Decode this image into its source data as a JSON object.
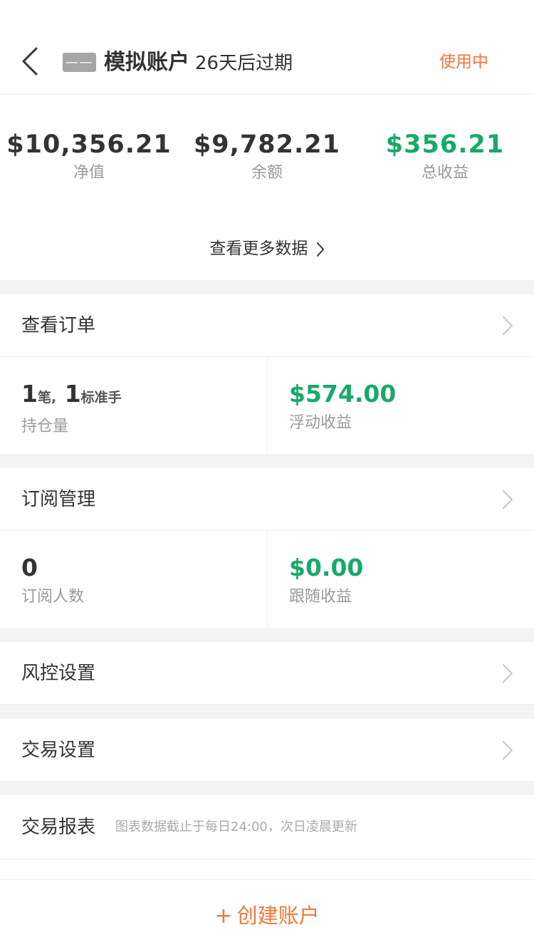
{
  "header": {
    "back_icon": "chevron-left-icon",
    "badge": "——",
    "title": "模拟账户",
    "expiry": "26天后过期",
    "status": "使用中"
  },
  "summary": {
    "net_value": {
      "value": "$10,356.21",
      "label": "净值"
    },
    "balance": {
      "value": "$9,782.21",
      "label": "余额"
    },
    "total_profit": {
      "value": "$356.21",
      "label": "总收益"
    },
    "more_link": "查看更多数据"
  },
  "orders": {
    "label": "查看订单",
    "positions_count": "1",
    "positions_unit": "笔,",
    "lots_count": "1",
    "lots_unit": "标准手",
    "positions_label": "持仓量",
    "floating_value": "$574.00",
    "floating_label": "浮动收益"
  },
  "subscription": {
    "label": "订阅管理",
    "subscribers": "0",
    "subscribers_label": "订阅人数",
    "follow_value": "$0.00",
    "follow_label": "跟随收益"
  },
  "risk": {
    "label": "风控设置"
  },
  "trade_settings": {
    "label": "交易设置"
  },
  "report": {
    "label": "交易报表",
    "note": "图表数据截止于每日24:00，次日凌晨更新"
  },
  "footer": {
    "create_label": "创建账户",
    "plus": "+"
  },
  "colors": {
    "accent": "#f0773a",
    "positive": "#17a968",
    "divider": "#f4f4f4"
  }
}
